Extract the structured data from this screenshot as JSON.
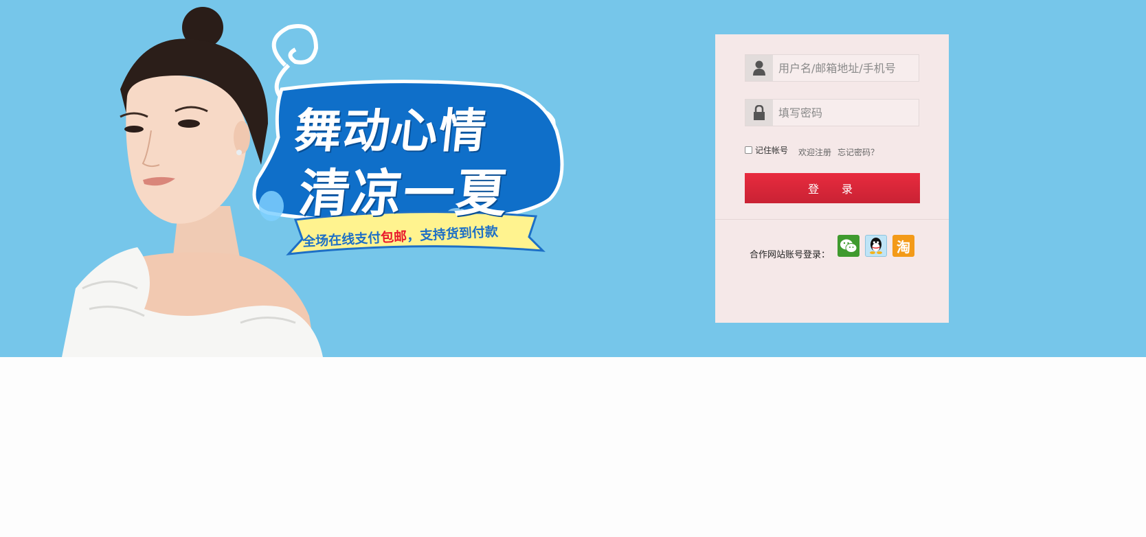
{
  "banner": {
    "line1": "舞动心情",
    "line2": "清凉一夏",
    "ribbon_pre": "全场在线支付",
    "ribbon_highlight": "包邮",
    "ribbon_post": "，支持货到付款"
  },
  "login": {
    "username_placeholder": "用户名/邮箱地址/手机号",
    "password_placeholder": "填写密码",
    "remember_label": "记住帐号",
    "register_link": "欢迎注册",
    "forgot_link": "忘记密码？",
    "submit_label": "登 录",
    "partner_label": "合作网站账号登录：",
    "partner_icons": [
      "wechat-icon",
      "qq-icon",
      "taobao-icon"
    ],
    "taobao_glyph": "淘"
  },
  "colors": {
    "hero_bg": "#76c6ea",
    "panel_bg": "#f5e8e8",
    "button": "#e02a3c",
    "ribbon_highlight": "#e8192c"
  }
}
